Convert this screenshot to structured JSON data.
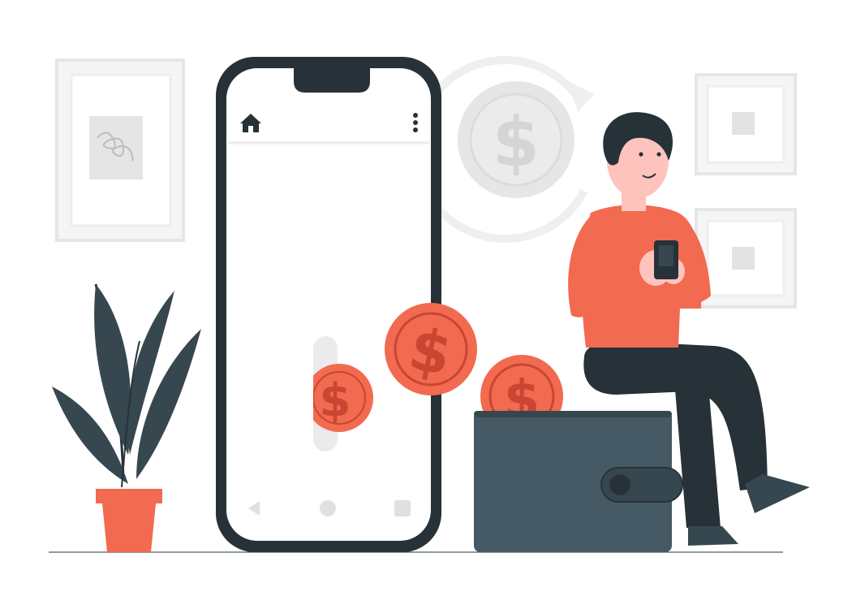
{
  "scene": {
    "currency_symbol": "$",
    "colors": {
      "accent": "#F26A50",
      "accent_dark": "#C94632",
      "dark": "#263238",
      "wallet": "#455A64",
      "light_gray": "#EBEBEB",
      "mid_gray": "#E0E0E0",
      "skin": "#FFC3BD",
      "hair": "#263238"
    },
    "icons": {
      "phone_top_left": "home-icon",
      "phone_top_right": "more-vertical-icon",
      "nav_back": "back-triangle-icon",
      "nav_home": "home-circle-icon",
      "nav_recent": "recent-square-icon"
    }
  }
}
